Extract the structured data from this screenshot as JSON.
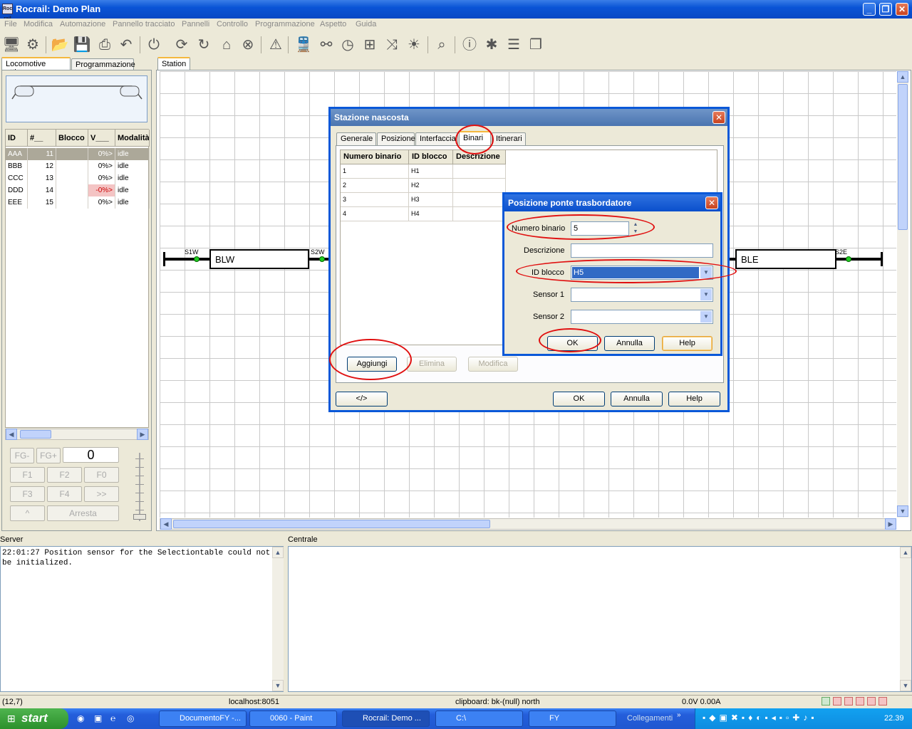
{
  "window": {
    "title": "Rocrail: Demo Plan",
    "icon_text": "Roc rail"
  },
  "menu": [
    "File",
    "Modifica",
    "Automazione",
    "Pannello tracciato",
    "Pannelli",
    "Controllo",
    "Programmazione",
    "Aspetto",
    "Guida"
  ],
  "toolbar_icons": [
    "monitor-icon",
    "gear-icon",
    "open-folder-icon",
    "save-icon",
    "print-icon",
    "undo-icon",
    "power-icon",
    "refresh-icon",
    "rotate-icon",
    "home-icon",
    "cancel-icon",
    "warning-icon",
    "locomotive-icon",
    "wagons-icon",
    "clock-icon",
    "network-icon",
    "shuffle-icon",
    "light-icon",
    "search-icon",
    "info-icon",
    "bug-icon",
    "list-icon",
    "pages-icon"
  ],
  "left_tabs": {
    "active": "Locomotive attive",
    "other": "Programmazione"
  },
  "loco_table": {
    "headers": [
      "ID",
      "#__",
      "Blocco",
      "V___",
      "Modalità"
    ],
    "rows": [
      {
        "id": "AAA",
        "num": "11",
        "block": "",
        "speed": "0%>",
        "mode": "idle"
      },
      {
        "id": "BBB",
        "num": "12",
        "block": "",
        "speed": "0%>",
        "mode": "idle"
      },
      {
        "id": "CCC",
        "num": "13",
        "block": "",
        "speed": "0%>",
        "mode": "idle"
      },
      {
        "id": "DDD",
        "num": "14",
        "block": "",
        "speed": "-0%>",
        "mode": "idle"
      },
      {
        "id": "EEE",
        "num": "15",
        "block": "",
        "speed": "0%>",
        "mode": "idle"
      }
    ]
  },
  "throttle": {
    "fg_minus": "FG-",
    "fg_plus": "FG+",
    "speed": "0",
    "f1": "F1",
    "f2": "F2",
    "f0": "F0",
    "f3": "F3",
    "f4": "F4",
    "next": ">>",
    "up": "^",
    "stop": "Arresta"
  },
  "plan_tab": "Station",
  "plan": {
    "blocks": [
      {
        "label": "BLW"
      },
      {
        "label": "BLE"
      }
    ],
    "signals": [
      "S1W",
      "S2W",
      "S2E"
    ]
  },
  "station_dialog": {
    "title": "Stazione nascosta",
    "tabs": [
      "Generale",
      "Posizione",
      "Interfaccia",
      "Binari",
      "Itinerari"
    ],
    "active_tab": "Binari",
    "grid_headers": [
      "Numero binario",
      "ID blocco",
      "Descrizione"
    ],
    "grid_rows": [
      {
        "num": "1",
        "block": "H1",
        "desc": ""
      },
      {
        "num": "2",
        "block": "H2",
        "desc": ""
      },
      {
        "num": "3",
        "block": "H3",
        "desc": ""
      },
      {
        "num": "4",
        "block": "H4",
        "desc": ""
      }
    ],
    "add": "Aggiungi",
    "delete": "Elimina",
    "modify": "Modifica",
    "xml": "</>",
    "ok": "OK",
    "cancel": "Annulla",
    "help": "Help"
  },
  "bridge_dialog": {
    "title": "Posizione ponte trasbordatore",
    "track_number_label": "Numero binario",
    "track_number": "5",
    "description_label": "Descrizione",
    "description": "",
    "block_id_label": "ID blocco",
    "block_id": "H5",
    "sensor1_label": "Sensor 1",
    "sensor1": "",
    "sensor2_label": "Sensor 2",
    "sensor2": "",
    "ok": "OK",
    "cancel": "Annulla",
    "help": "Help"
  },
  "server_label": "Server",
  "server_log": "22:01:27 Position sensor for the Selectiontable could not be initialized.",
  "central_label": "Centrale",
  "status": {
    "coords": "(12,7)",
    "host": "localhost:8051",
    "clipboard": "clipboard: bk-(null) north",
    "power": "0.0V 0.00A"
  },
  "taskbar": {
    "start": "start",
    "tasks": [
      "DocumentoFY -...",
      "0060 - Paint",
      "Rocrail: Demo ...",
      "C:\\",
      "FY"
    ],
    "links": "Collegamenti",
    "clock": "22.39"
  }
}
